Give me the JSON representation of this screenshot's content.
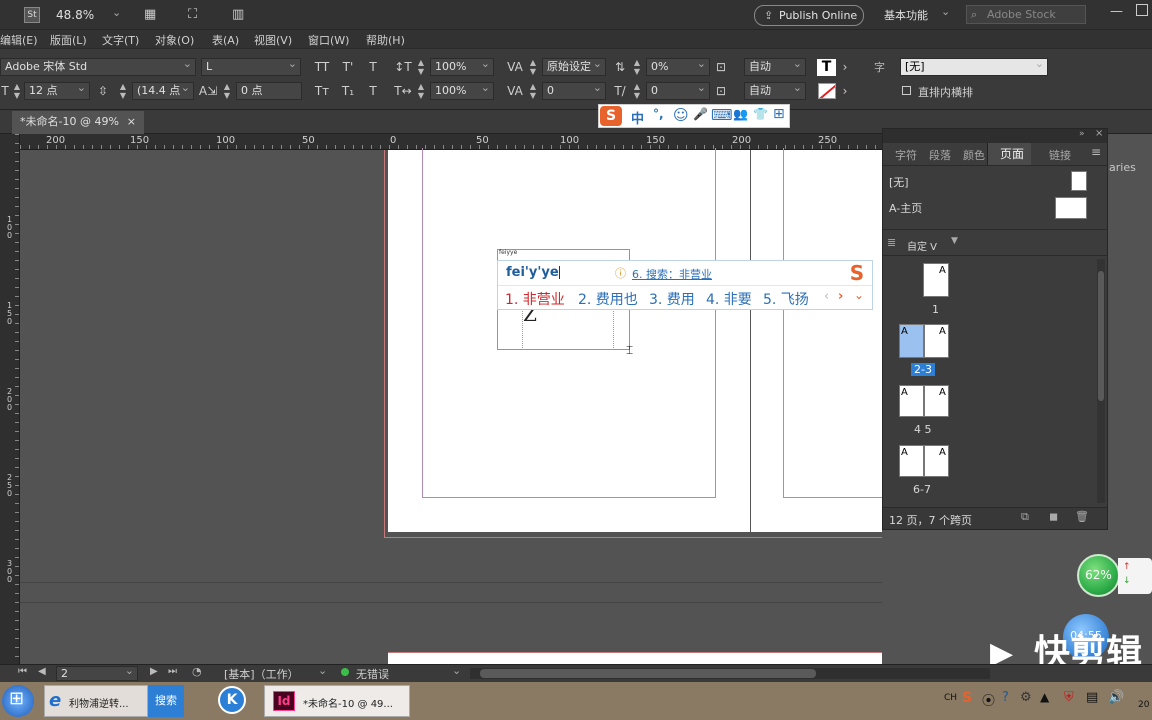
{
  "appbar": {
    "st_badge": "St",
    "zoom": "48.8%",
    "publish_button": "Publish Online",
    "workspace": "基本功能",
    "search_placeholder": "Adobe Stock"
  },
  "menu": {
    "items": [
      "编辑(E)",
      "版面(L)",
      "文字(T)",
      "对象(O)",
      "表(A)",
      "视图(V)",
      "窗口(W)",
      "帮助(H)"
    ]
  },
  "control": {
    "font_family": "Adobe 宋体 Std",
    "font_style": "L",
    "font_size": "12 点",
    "leading": "(14.4 点",
    "kerning": "0 点",
    "vscale": "100%",
    "hscale": "100%",
    "tracking_mode": "原始设定",
    "tracking_val": "0",
    "baseline": "0%",
    "baseline2": "0",
    "auto1": "自动",
    "auto2": "自动",
    "char_style_label": "字",
    "char_style": "[无]",
    "checkbox_label": "直排内横排"
  },
  "doc_tab": {
    "title": "*未命名-10 @ 49%",
    "close": "×"
  },
  "rulers": {
    "h_labels": [
      "200",
      "150",
      "100",
      "50",
      "0",
      "50",
      "100",
      "150",
      "200",
      "250"
    ],
    "v_labels": [
      "1 0 0",
      "1 5 0",
      "2 0 0",
      "2 5 0",
      "3 0 0"
    ]
  },
  "canvas": {
    "frame_label": "feiyye",
    "frame_glyph": "Z"
  },
  "ime": {
    "bar_items": [
      "S",
      "中",
      "°,",
      "☺",
      "🎤",
      "⌨",
      "👥",
      "👕",
      "⊞"
    ],
    "pinyin": "fei'y'ye",
    "search_hint": "6. 搜索：非营业",
    "candidates": [
      "1. 非营业",
      "2. 费用也",
      "3. 费用",
      "4. 非要",
      "5. 飞扬"
    ]
  },
  "panel": {
    "tabs": [
      "字符",
      "段落",
      "颜色",
      "页面",
      "链接"
    ],
    "active_tab": "页面",
    "partial_text": "aries",
    "master_none": "[无]",
    "master_a": "A-主页",
    "view_dropdown": "自定 V",
    "page_labels": [
      "1",
      "2-3",
      "4 5",
      "6-7"
    ],
    "footer_text": "12 页，7 个跨页"
  },
  "status": {
    "page_field": "2",
    "preflight_profile": "[基本]（工作）",
    "errors": "无错误"
  },
  "taskbar": {
    "item1": "利物浦逆转...",
    "search": "搜索",
    "k_app": "K",
    "id_app": "Id",
    "id_title": "*未命名-10 @ 49...",
    "tray_ch": "CH",
    "date_partial": "20"
  },
  "overlay": {
    "cpu_percent": "62%",
    "clock": "04:55",
    "watermark": "快剪辑"
  },
  "colors": {
    "accent": "#2d7fd6",
    "ime_red": "#d2262a",
    "ime_blue": "#2a6fb7",
    "page_guide": "#b48ab4",
    "green_gauge": "#2fae4a"
  }
}
